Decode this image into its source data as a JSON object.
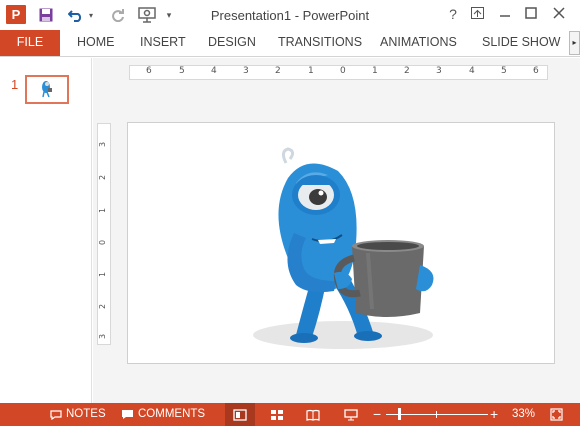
{
  "app": {
    "title": "Presentation1 - PowerPoint",
    "logo_letter": "P"
  },
  "quick_access": {
    "save_icon": "save-icon",
    "undo_icon": "undo-icon",
    "redo_icon": "redo-icon",
    "present_icon": "start-from-beginning-icon",
    "customize_icon": "customize-qat-icon"
  },
  "window_controls": {
    "help": "?",
    "ribbon_display": "ribbon-display-icon",
    "minimize": "minimize-icon",
    "restore": "restore-icon",
    "close": "close-icon"
  },
  "ribbon": {
    "tabs": [
      "FILE",
      "HOME",
      "INSERT",
      "DESIGN",
      "TRANSITIONS",
      "ANIMATIONS",
      "SLIDE SHOW"
    ],
    "scroll_glyph": "▸"
  },
  "thumbnails": [
    {
      "number": "1"
    }
  ],
  "ruler": {
    "horizontal": [
      "6",
      "5",
      "4",
      "3",
      "2",
      "1",
      "0",
      "1",
      "2",
      "3",
      "4",
      "5",
      "6"
    ],
    "vertical": [
      "3",
      "2",
      "1",
      "0",
      "1",
      "2",
      "3"
    ]
  },
  "statusbar": {
    "notes_label": "NOTES",
    "comments_label": "COMMENTS",
    "zoom_level": "33%",
    "zoom_minus": "−",
    "zoom_plus": "+"
  },
  "colors": {
    "accent": "#d24726",
    "accent_dark": "#a8391e",
    "character_blue": "#2b8fd8",
    "mug_gray": "#6a6a6a"
  }
}
